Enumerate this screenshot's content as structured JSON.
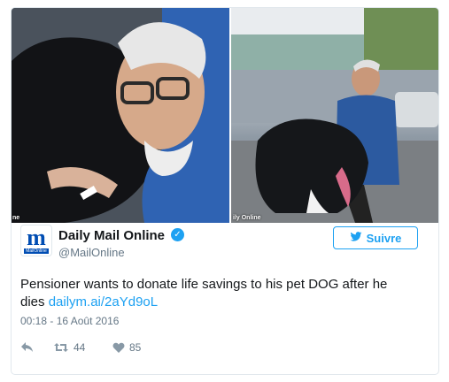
{
  "tweet": {
    "author_name": "Daily Mail Online",
    "author_handle": "@MailOnline",
    "avatar_letter": "m",
    "avatar_text": "MailOnline",
    "follow_label": "Suivre",
    "body_text": "Pensioner wants to donate life savings to his pet DOG after he dies",
    "link_text": "dailym.ai/2aYd9oL",
    "timestamp": "00:18 - 16 Août 2016",
    "retweet_count": "44",
    "like_count": "85"
  },
  "media": {
    "left_caption": "ne",
    "right_caption": "ily Online"
  },
  "icons": {
    "verified": "verified-badge-icon",
    "follow": "twitter-bird-icon",
    "reply": "reply-icon",
    "retweet": "retweet-icon",
    "like": "heart-icon"
  },
  "colors": {
    "accent": "#1da1f2",
    "text": "#14171a",
    "muted": "#657786",
    "border": "#e1e8ed",
    "brand_blue": "#004db3"
  }
}
